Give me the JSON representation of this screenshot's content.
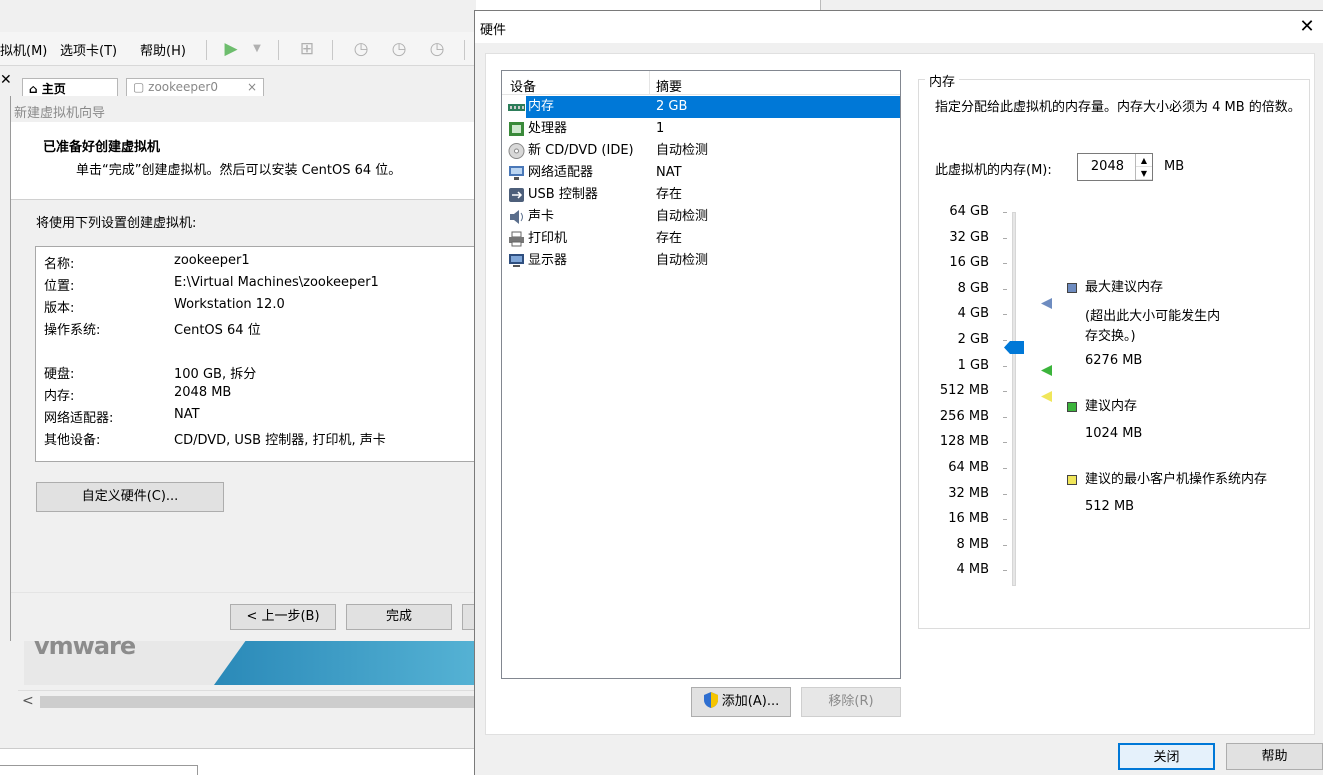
{
  "background_window": {
    "menus": [
      "拟机(M)",
      "选项卡(T)",
      "帮助(H)"
    ],
    "tabs": [
      "主页",
      "zookeeper0"
    ],
    "wizard": {
      "title": "新建虚拟机向导",
      "heading": "已准备好创建虚拟机",
      "subheading": "单击“完成”创建虚拟机。然后可以安装 CentOS 64 位。",
      "intro": "将使用下列设置创建虚拟机:",
      "summary": [
        {
          "key": "名称:",
          "value": "zookeeper1"
        },
        {
          "key": "位置:",
          "value": "E:\\Virtual Machines\\zookeeper1"
        },
        {
          "key": "版本:",
          "value": "Workstation 12.0"
        },
        {
          "key": "操作系统:",
          "value": "CentOS 64 位"
        },
        {
          "key": "硬盘:",
          "value": "100 GB, 拆分"
        },
        {
          "key": "内存:",
          "value": "2048 MB"
        },
        {
          "key": "网络适配器:",
          "value": "NAT"
        },
        {
          "key": "其他设备:",
          "value": "CD/DVD, USB 控制器, 打印机, 声卡"
        }
      ],
      "customize_button": "自定义硬件(C)...",
      "back_button": "< 上一步(B)",
      "finish_button": "完成"
    },
    "logo": "vmware"
  },
  "dialog": {
    "title": "硬件",
    "devices_header": {
      "device": "设备",
      "summary": "摘要"
    },
    "devices": [
      {
        "name": "内存",
        "summary": "2 GB",
        "icon": "memory-icon",
        "selected": true
      },
      {
        "name": "处理器",
        "summary": "1",
        "icon": "cpu-icon",
        "selected": false
      },
      {
        "name": "新 CD/DVD (IDE)",
        "summary": "自动检测",
        "icon": "cd-icon",
        "selected": false
      },
      {
        "name": "网络适配器",
        "summary": "NAT",
        "icon": "network-icon",
        "selected": false
      },
      {
        "name": "USB 控制器",
        "summary": "存在",
        "icon": "usb-icon",
        "selected": false
      },
      {
        "name": "声卡",
        "summary": "自动检测",
        "icon": "sound-icon",
        "selected": false
      },
      {
        "name": "打印机",
        "summary": "存在",
        "icon": "printer-icon",
        "selected": false
      },
      {
        "name": "显示器",
        "summary": "自动检测",
        "icon": "display-icon",
        "selected": false
      }
    ],
    "add_button": "添加(A)...",
    "remove_button": "移除(R)",
    "memory": {
      "group_title": "内存",
      "description": "指定分配给此虚拟机的内存量。内存大小必须为 4 MB 的倍数。",
      "field_label": "此虚拟机的内存(M):",
      "value": "2048",
      "unit": "MB",
      "scale": [
        "64 GB",
        "32 GB",
        "16 GB",
        "8 GB",
        "4 GB",
        "2 GB",
        "1 GB",
        "512 MB",
        "256 MB",
        "128 MB",
        "64 MB",
        "32 MB",
        "16 MB",
        "8 MB",
        "4 MB"
      ],
      "max_recommended": {
        "label": "最大建议内存",
        "note": "(超出此大小可能发生内存交换。)",
        "value": "6276 MB",
        "color": "#6e8cc0"
      },
      "recommended": {
        "label": "建议内存",
        "value": "1024 MB",
        "color": "#3cb43c"
      },
      "min_guest": {
        "label": "建议的最小客户机操作系统内存",
        "value": "512 MB",
        "color": "#f0e65a"
      }
    },
    "close_button": "关闭",
    "help_button": "帮助"
  }
}
